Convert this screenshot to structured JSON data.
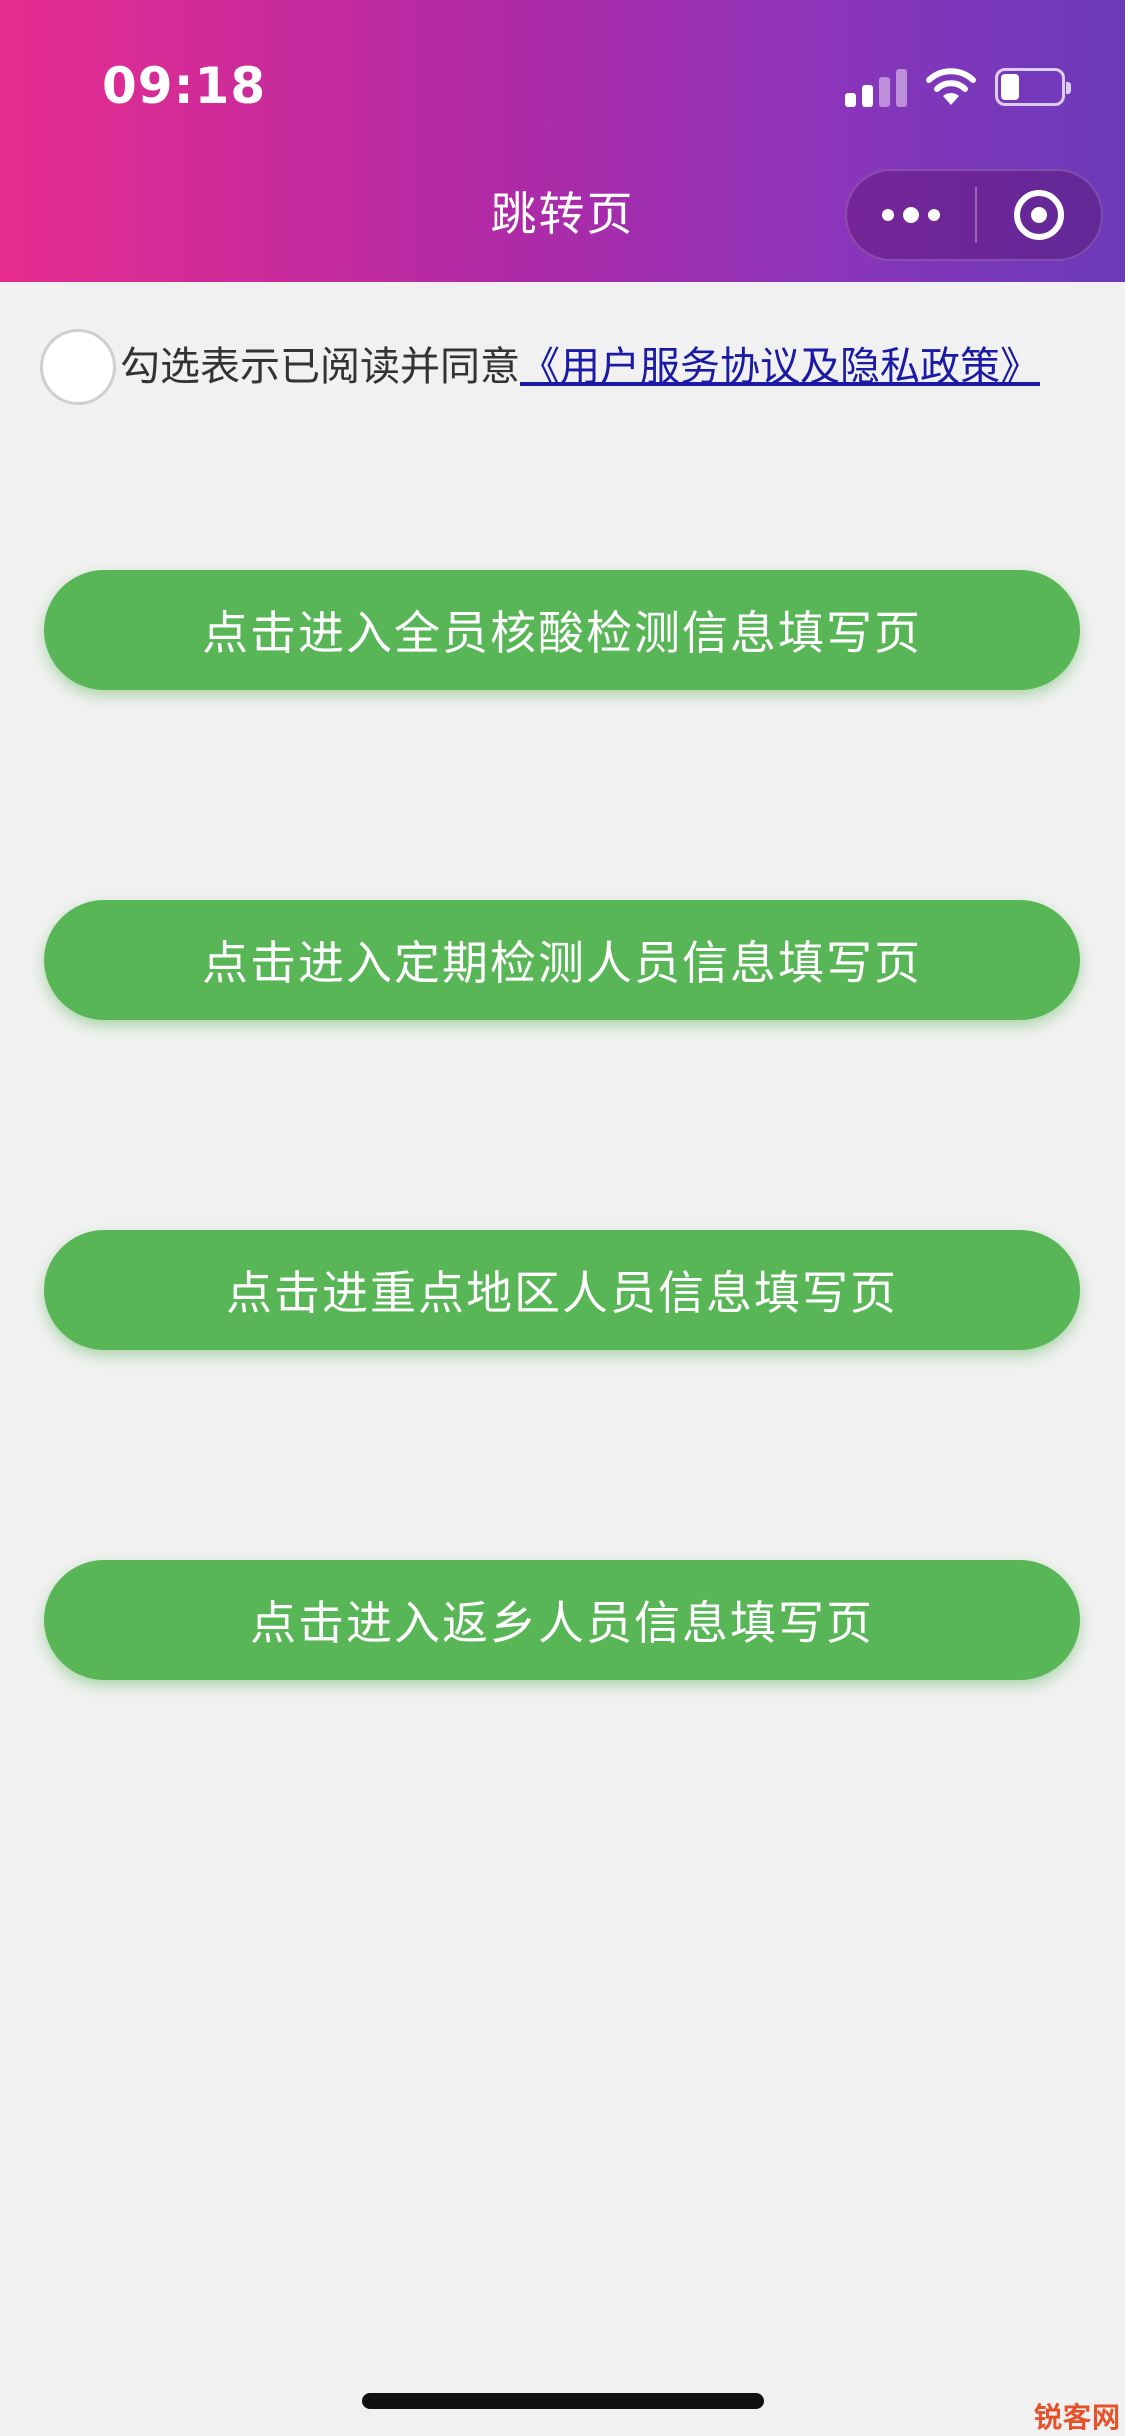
{
  "status_bar": {
    "time": "09:18",
    "icons": [
      "cellular-signal-icon",
      "wifi-icon",
      "battery-icon"
    ]
  },
  "header": {
    "title": "跳转页",
    "capsule": {
      "more_icon": "more-dots-icon",
      "close_icon": "target-close-icon"
    }
  },
  "agreement": {
    "text": "勾选表示已阅读并同意",
    "link": "《用户服务协议及隐私政策》",
    "checked": false
  },
  "buttons": [
    {
      "label": "点击进入全员核酸检测信息填写页"
    },
    {
      "label": "点击进入定期检测人员信息填写页"
    },
    {
      "label": "点击进重点地区人员信息填写页"
    },
    {
      "label": "点击进入返乡人员信息填写页"
    }
  ],
  "watermark": "锐客网",
  "colors": {
    "header_gradient_start": "#e72c8f",
    "header_gradient_end": "#6b3ab9",
    "button_green": "#58b657",
    "background": "#f1f1f1",
    "link_blue": "#1a1aa6"
  }
}
